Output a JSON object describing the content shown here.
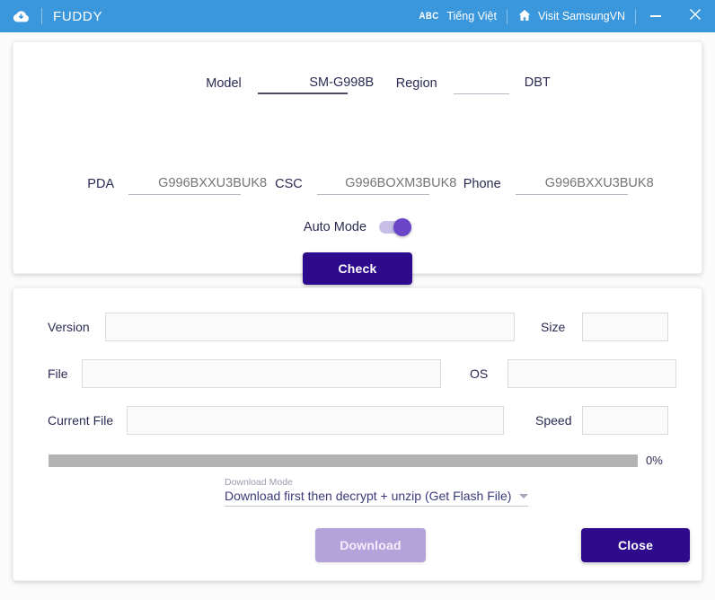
{
  "window": {
    "title": "FUDDY",
    "logo_icon": "cloud-download-icon",
    "language_icon": "abc-icon",
    "language_label": "Tiếng Việt",
    "home_icon": "home-icon",
    "visit_label": "Visit SamsungVN",
    "minimize_icon": "minimize-icon",
    "close_icon": "close-icon",
    "titlebar_color": "#3a97dc"
  },
  "firmware": {
    "model_label": "Model",
    "model_value": "SM-G998B",
    "region_label": "Region",
    "region_value": "DBT",
    "pda_label": "PDA",
    "pda_placeholder": "G996BXXU3BUK8",
    "pda_value": "",
    "csc_label": "CSC",
    "csc_placeholder": "G996BOXM3BUK8",
    "csc_value": "",
    "phone_label": "Phone",
    "phone_placeholder": "G996BXXU3BUK8",
    "phone_value": "",
    "auto_mode_label": "Auto Mode",
    "auto_mode_on": true,
    "check_label": "Check"
  },
  "download": {
    "version_label": "Version",
    "version_value": "",
    "size_label": "Size",
    "size_value": "",
    "file_label": "File",
    "file_value": "",
    "os_label": "OS",
    "os_value": "",
    "current_file_label": "Current File",
    "current_file_value": "",
    "speed_label": "Speed",
    "speed_value": "",
    "progress_percent_label": "0%",
    "progress_percent": 0,
    "mode_label": "Download Mode",
    "mode_value": "Download first then decrypt + unzip (Get Flash File)",
    "mode_caret_icon": "chevron-down-icon",
    "download_label": "Download",
    "download_enabled": false,
    "close_label": "Close"
  },
  "colors": {
    "accent": "#2e0a8c",
    "toggle_on": "#6a45c8",
    "disabled": "#b3a3da",
    "titlebar": "#3a97dc",
    "progress_track": "#b3b3b3"
  }
}
